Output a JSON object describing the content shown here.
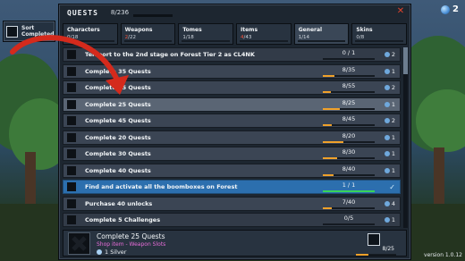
{
  "sort": {
    "label_line1": "Sort",
    "label_line2": "Completed"
  },
  "gems": {
    "count": "2"
  },
  "version": "version 1.0.12",
  "panel": {
    "title": "QUESTS",
    "count": "8/236"
  },
  "tabs": [
    {
      "label": "Characters",
      "count_done": "0",
      "count_total": "/18",
      "active": false,
      "red": false
    },
    {
      "label": "Weapons",
      "count_done": "2",
      "count_total": "/22",
      "active": false,
      "red": true
    },
    {
      "label": "Tomes",
      "count_done": "1",
      "count_total": "/18",
      "active": false,
      "red": false
    },
    {
      "label": "Items",
      "count_done": "4",
      "count_total": "/43",
      "active": false,
      "red": true
    },
    {
      "label": "General",
      "count_done": "1",
      "count_total": "/14",
      "active": true,
      "red": false
    },
    {
      "label": "Skins",
      "count_done": "0",
      "count_total": "/8",
      "active": false,
      "red": false
    }
  ],
  "quests": [
    {
      "name": "Teleport to the 2nd stage on Forest Tier 2 as CL4NK",
      "progress": "0 / 1",
      "fill": 0,
      "reward": "2",
      "reward_type": "silver",
      "state": "dim"
    },
    {
      "name": "Complete 35 Quests",
      "progress": "8/35",
      "fill": 0.23,
      "reward": "1",
      "reward_type": "silver",
      "state": "normal"
    },
    {
      "name": "Complete 55 Quests",
      "progress": "8/55",
      "fill": 0.15,
      "reward": "2",
      "reward_type": "silver",
      "state": "normal"
    },
    {
      "name": "Complete 25 Quests",
      "progress": "8/25",
      "fill": 0.32,
      "reward": "1",
      "reward_type": "silver",
      "state": "hover"
    },
    {
      "name": "Complete 45 Quests",
      "progress": "8/45",
      "fill": 0.18,
      "reward": "2",
      "reward_type": "silver",
      "state": "normal"
    },
    {
      "name": "Complete 20 Quests",
      "progress": "8/20",
      "fill": 0.4,
      "reward": "1",
      "reward_type": "silver",
      "state": "normal"
    },
    {
      "name": "Complete 30 Quests",
      "progress": "8/30",
      "fill": 0.27,
      "reward": "1",
      "reward_type": "silver",
      "state": "normal"
    },
    {
      "name": "Complete 40 Quests",
      "progress": "8/40",
      "fill": 0.2,
      "reward": "1",
      "reward_type": "silver",
      "state": "normal"
    },
    {
      "name": "Find and activate all the boomboxes on Forest",
      "progress": "1 / 1",
      "fill": 1,
      "reward": "✓",
      "reward_type": "done",
      "state": "done"
    },
    {
      "name": "Purchase 40 unlocks",
      "progress": "7/40",
      "fill": 0.18,
      "reward": "4",
      "reward_type": "silver",
      "state": "normal"
    },
    {
      "name": "Complete 5 Challenges",
      "progress": "0/5",
      "fill": 0,
      "reward": "1",
      "reward_type": "silver",
      "state": "dim"
    }
  ],
  "detail": {
    "title": "Complete 25 Quests",
    "subtitle": "Shop item - Weapon Slots",
    "reward": "1 Silver",
    "progress": "8/25",
    "fill": 0.32
  },
  "colors": {
    "accent": "#2c6fae",
    "bar": "#f0a12a",
    "close": "#e2432c"
  }
}
